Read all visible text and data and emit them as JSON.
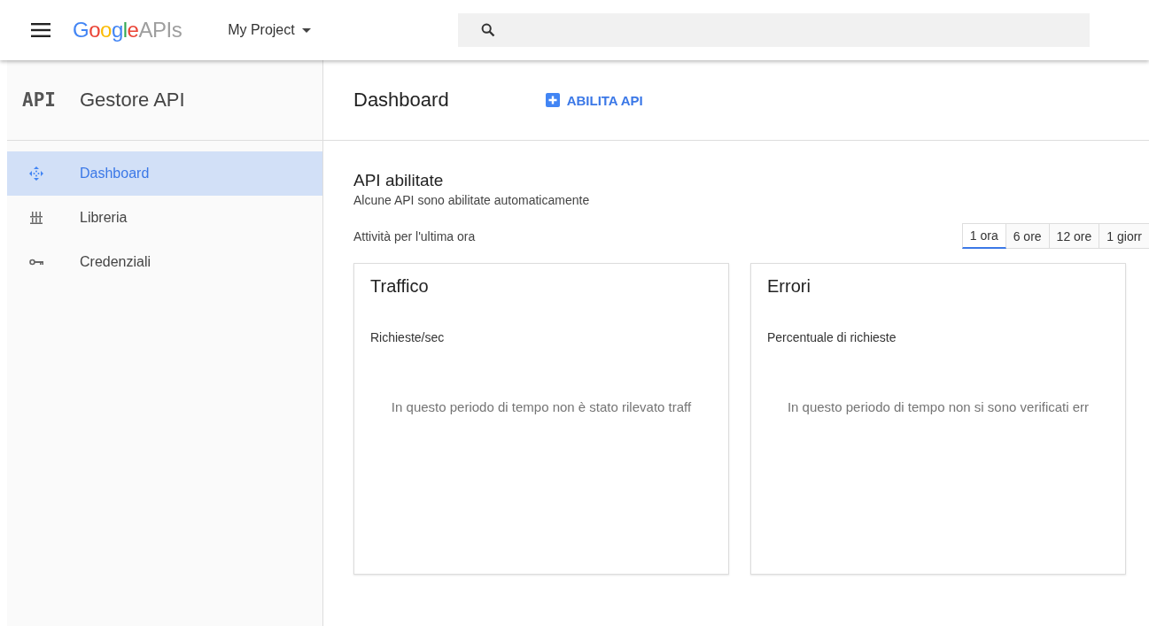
{
  "topbar": {
    "logo": {
      "brand": "Google",
      "product": "APIs"
    },
    "project": "My Project"
  },
  "sidebar": {
    "badge": "API",
    "title": "Gestore API",
    "items": [
      {
        "label": "Dashboard",
        "kind": "dashboard",
        "selected": true
      },
      {
        "label": "Libreria",
        "kind": "library",
        "selected": false
      },
      {
        "label": "Credenziali",
        "kind": "key",
        "selected": false
      }
    ]
  },
  "main": {
    "title": "Dashboard",
    "enable_button": "ABILITA API",
    "section_title": "API abilitate",
    "section_subtitle": "Alcune API sono abilitate automaticamente",
    "activity_label": "Attività per l'ultima ora",
    "ranges": [
      {
        "label": "1 ora",
        "selected": true
      },
      {
        "label": "6 ore",
        "selected": false
      },
      {
        "label": "12 ore",
        "selected": false
      },
      {
        "label": "1 giorr",
        "selected": false
      }
    ],
    "cards": [
      {
        "title": "Traffico",
        "subtitle": "Richieste/sec",
        "message": "In questo periodo di tempo non è stato rilevato traff"
      },
      {
        "title": "Errori",
        "subtitle": "Percentuale di richieste",
        "message": "In questo periodo di tempo non si sono verificati err"
      }
    ]
  }
}
